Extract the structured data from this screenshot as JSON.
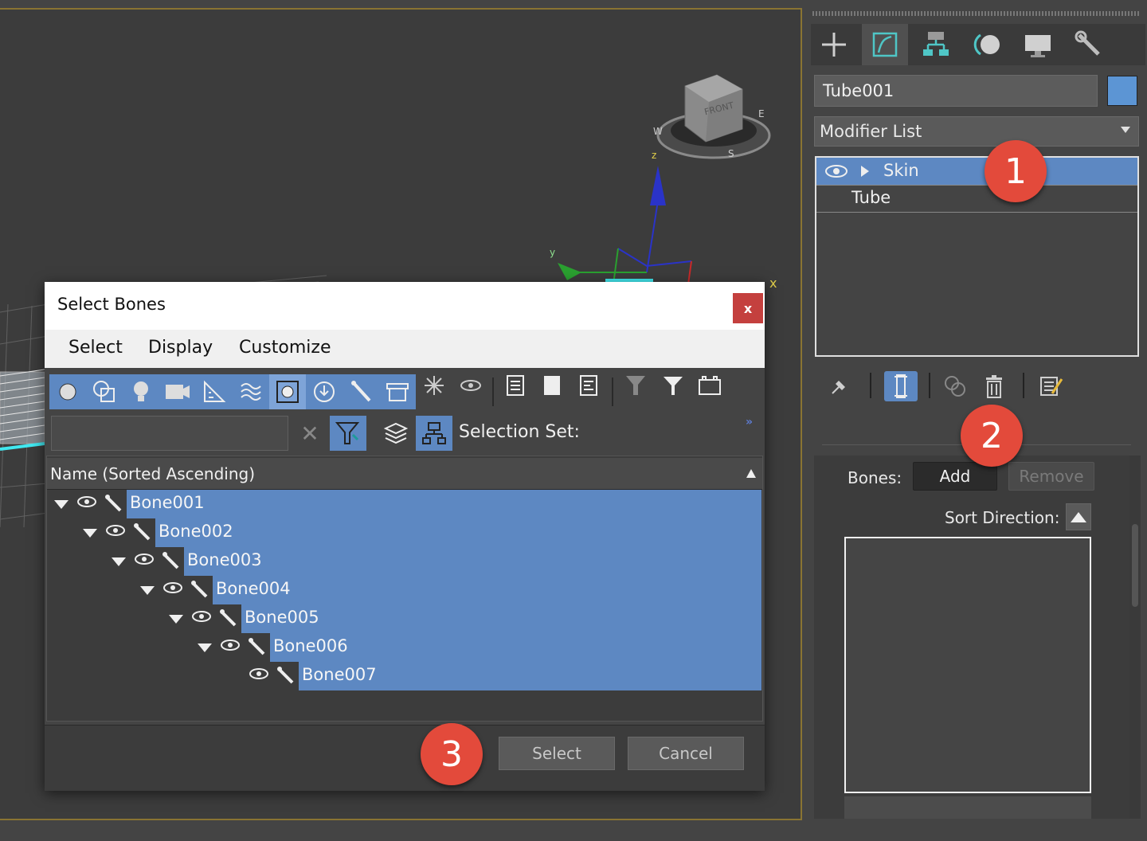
{
  "viewport": {
    "axis_x_label": "x",
    "viewcube_front": "FRONT",
    "compass_w": "W",
    "compass_s": "S",
    "compass_e": "E",
    "gizmo_z": "z",
    "gizmo_y": "y"
  },
  "command_panel": {
    "tabs": [
      {
        "icon": "create-icon"
      },
      {
        "icon": "modify-icon",
        "active": true
      },
      {
        "icon": "hierarchy-icon"
      },
      {
        "icon": "motion-icon"
      },
      {
        "icon": "display-icon"
      },
      {
        "icon": "utilities-icon"
      }
    ],
    "object_name": "Tube001",
    "object_color": "#5c95d4",
    "modifier_list": "Modifier List",
    "stack": [
      {
        "label": "Skin",
        "selected": true
      },
      {
        "label": "Tube",
        "selected": false
      }
    ],
    "stack_tools": [
      "pin-icon",
      "show-end-result-icon",
      "make-unique-icon",
      "remove-modifier-icon",
      "configure-sets-icon"
    ],
    "bones_label": "Bones:",
    "add_label": "Add",
    "remove_label": "Remove",
    "sort_label": "Sort Direction:"
  },
  "dialog": {
    "title": "Select Bones",
    "close": "x",
    "menu": [
      "Select",
      "Display",
      "Customize"
    ],
    "selection_set_label": "Selection Set:",
    "more": "»",
    "column_header": "Name (Sorted Ascending)",
    "rows": [
      "Bone001",
      "Bone002",
      "Bone003",
      "Bone004",
      "Bone005",
      "Bone006",
      "Bone007"
    ],
    "select_button": "Select",
    "cancel_button": "Cancel"
  },
  "callouts": [
    "1",
    "2",
    "3"
  ],
  "colors": {
    "selection": "#5d88c2",
    "callout": "#e34a3b",
    "viewport_border": "#8a7432"
  }
}
